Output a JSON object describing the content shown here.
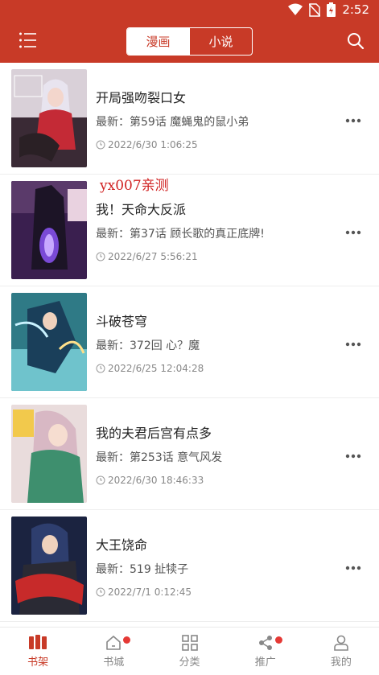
{
  "status": {
    "time": "2:52"
  },
  "header": {
    "tabs": [
      {
        "label": "漫画",
        "active": true
      },
      {
        "label": "小说",
        "active": false
      }
    ]
  },
  "watermark": "yx007亲测",
  "comics": [
    {
      "title": "开局强吻裂口女",
      "latest": "最新：第59话 魔蝇鬼的鼠小弟",
      "time": "2022/6/30 1:06:25"
    },
    {
      "title": "我！天命大反派",
      "latest": "最新：第37话 顾长歌的真正底牌!",
      "time": "2022/6/27 5:56:21"
    },
    {
      "title": "斗破苍穹",
      "latest": "最新：372回 心？魔",
      "time": "2022/6/25 12:04:28"
    },
    {
      "title": "我的夫君后宫有点多",
      "latest": "最新：第253话 意气风发",
      "time": "2022/6/30 18:46:33"
    },
    {
      "title": "大王饶命",
      "latest": "最新：519 扯犊子",
      "time": "2022/7/1 0:12:45"
    }
  ],
  "tabbar": [
    {
      "label": "书架",
      "icon": "bookshelf-icon",
      "active": true,
      "badge": false
    },
    {
      "label": "书城",
      "icon": "home-icon",
      "active": false,
      "badge": true
    },
    {
      "label": "分类",
      "icon": "grid-icon",
      "active": false,
      "badge": false
    },
    {
      "label": "推广",
      "icon": "share-icon",
      "active": false,
      "badge": true
    },
    {
      "label": "我的",
      "icon": "user-icon",
      "active": false,
      "badge": false
    }
  ],
  "colors": {
    "primary": "#c83a27",
    "badge": "#e53935"
  }
}
